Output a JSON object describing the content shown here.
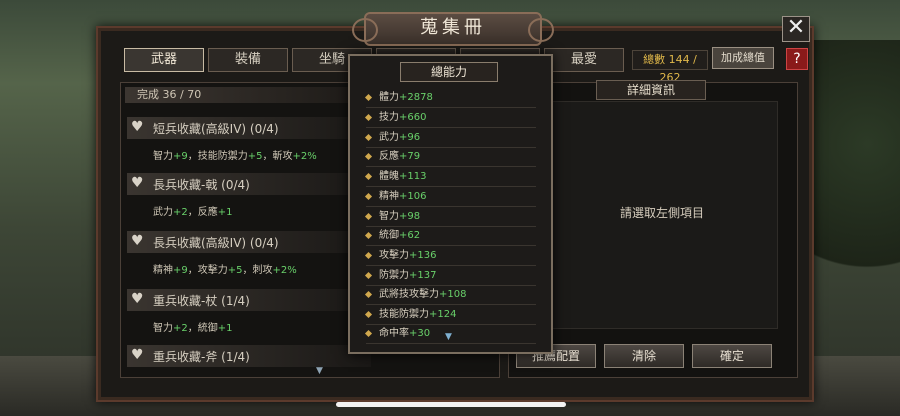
{
  "window": {
    "title": "蒐集冊",
    "close_icon": "close-icon",
    "help_label": "?"
  },
  "tabs": [
    {
      "label": "武器",
      "active": true
    },
    {
      "label": "裝備",
      "active": false
    },
    {
      "label": "坐騎",
      "active": false
    },
    {
      "label": "",
      "active": false
    },
    {
      "label": "",
      "active": false
    },
    {
      "label": "最愛",
      "active": false
    }
  ],
  "header": {
    "total_label": "總數 144 / 262",
    "bonus_button": "加成總值"
  },
  "collection": {
    "completion": "完成  36 / 70",
    "entries": [
      {
        "title": "短兵收藏(高級IV) (0/4)",
        "stats_prefix": "智力",
        "stats_a": "+9",
        "stats_mid1": "，技能防禦力",
        "stats_b": "+5",
        "stats_mid2": "，斬攻",
        "stats_c": "+2%"
      },
      {
        "title": "長兵收藏-戟 (0/4)",
        "stats_prefix": "武力",
        "stats_a": "+2",
        "stats_mid1": "，反應",
        "stats_b": "+1",
        "stats_mid2": "",
        "stats_c": ""
      },
      {
        "title": "長兵收藏(高級IV) (0/4)",
        "stats_prefix": "精神",
        "stats_a": "+9",
        "stats_mid1": "，攻擊力",
        "stats_b": "+5",
        "stats_mid2": "，刺攻",
        "stats_c": "+2%"
      },
      {
        "title": "重兵收藏-杖 (1/4)",
        "stats_prefix": "智力",
        "stats_a": "+2",
        "stats_mid1": "，統御",
        "stats_b": "+1",
        "stats_mid2": "",
        "stats_c": ""
      },
      {
        "title": "重兵收藏-斧 (1/4)",
        "stats_prefix": "",
        "stats_a": "",
        "stats_mid1": "",
        "stats_b": "",
        "stats_mid2": "",
        "stats_c": ""
      }
    ]
  },
  "total_stats": {
    "title": "總能力",
    "rows": [
      {
        "name": "體力",
        "value": "+2878"
      },
      {
        "name": "技力",
        "value": "+660"
      },
      {
        "name": "武力",
        "value": "+96"
      },
      {
        "name": "反應",
        "value": "+79"
      },
      {
        "name": "體魄",
        "value": "+113"
      },
      {
        "name": "精神",
        "value": "+106"
      },
      {
        "name": "智力",
        "value": "+98"
      },
      {
        "name": "統御",
        "value": "+62"
      },
      {
        "name": "攻擊力",
        "value": "+136"
      },
      {
        "name": "防禦力",
        "value": "+137"
      },
      {
        "name": "武將技攻擊力",
        "value": "+108"
      },
      {
        "name": "技能防禦力",
        "value": "+124"
      },
      {
        "name": "命中率",
        "value": "+30"
      }
    ]
  },
  "detail": {
    "label": "詳細資訊",
    "hint": "請選取左側項目"
  },
  "actions": {
    "recommend": "推薦配置",
    "clear": "清除",
    "confirm": "確定"
  }
}
